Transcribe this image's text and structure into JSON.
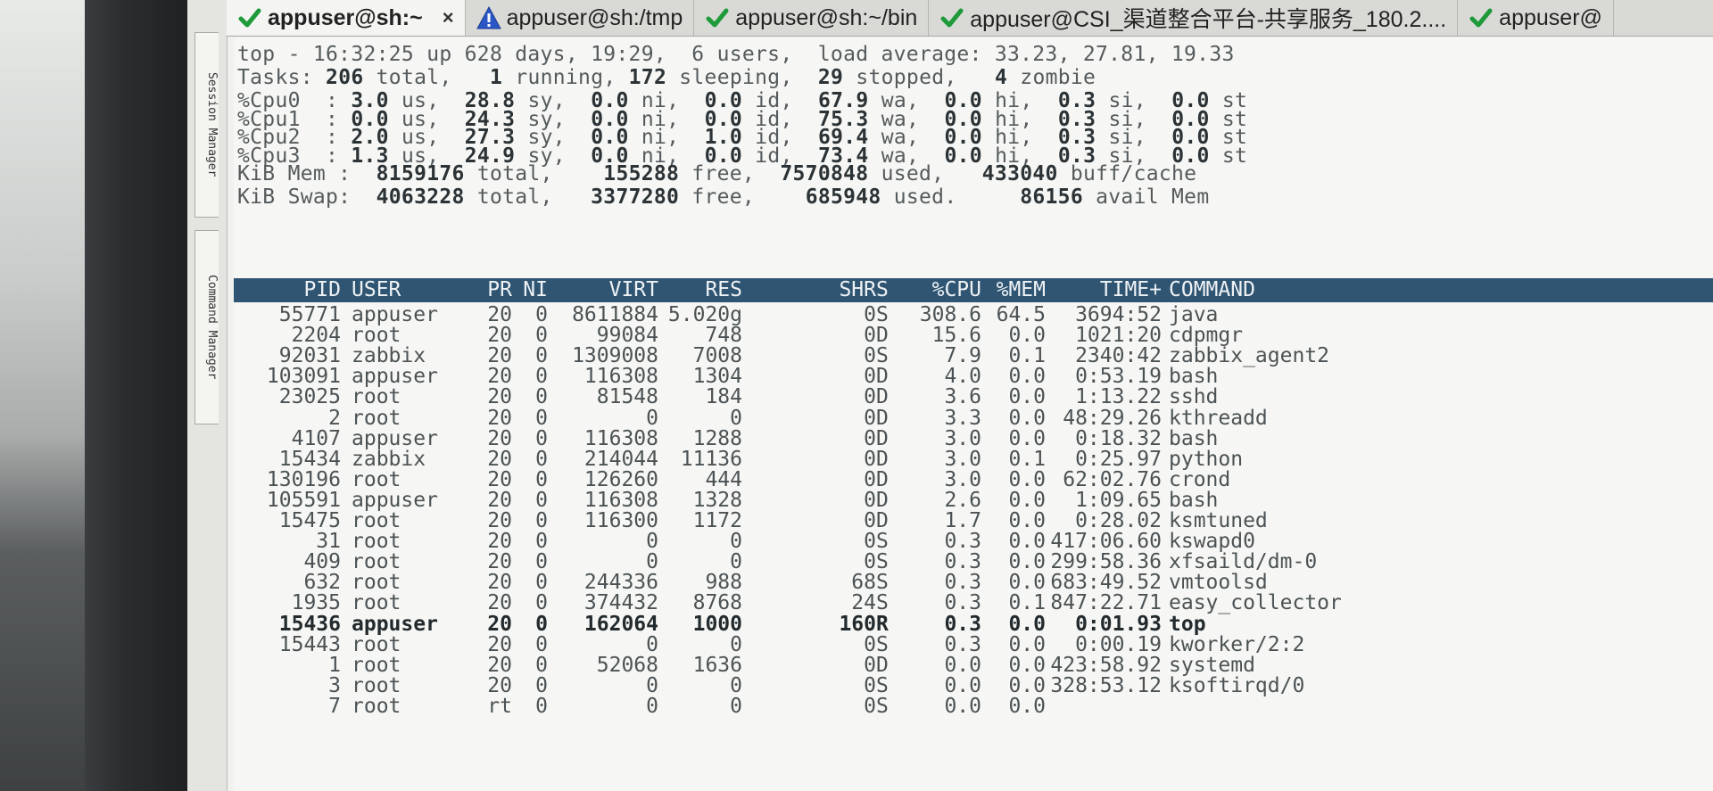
{
  "side_panel": {
    "session_manager": "Session Manager",
    "command_manager": "Command Manager"
  },
  "tabs": [
    {
      "label": "appuser@sh:~",
      "icon": "check-icon",
      "active": true,
      "close": "×"
    },
    {
      "label": "appuser@sh:/tmp",
      "icon": "warning-icon"
    },
    {
      "label": "appuser@sh:~/bin",
      "icon": "check-icon"
    },
    {
      "label": "appuser@CSI_渠道整合平台-共享服务_180.2....",
      "icon": "check-icon"
    },
    {
      "label": "appuser@",
      "icon": "check-icon"
    }
  ],
  "summary": {
    "line1": "top - 16:32:25 up 628 days, 19:29,  6 users,  load average: 33.23, 27.81, 19.33",
    "tasks": {
      "label": "Tasks:",
      "total": "206",
      "total_lbl": "total,",
      "running": "1",
      "running_lbl": "running,",
      "sleeping": "172",
      "sleeping_lbl": "sleeping,",
      "stopped": "29",
      "stopped_lbl": "stopped,",
      "zombie": "4",
      "zombie_lbl": "zombie"
    },
    "cpus": [
      {
        "label": "%Cpu0  :",
        "us": "3.0",
        "sy": "28.8",
        "ni": "0.0",
        "id": "0.0",
        "wa": "67.9",
        "hi": "0.0",
        "si": "0.3",
        "st": "0.0"
      },
      {
        "label": "%Cpu1  :",
        "us": "0.0",
        "sy": "24.3",
        "ni": "0.0",
        "id": "0.0",
        "wa": "75.3",
        "hi": "0.0",
        "si": "0.3",
        "st": "0.0"
      },
      {
        "label": "%Cpu2  :",
        "us": "2.0",
        "sy": "27.3",
        "ni": "0.0",
        "id": "1.0",
        "wa": "69.4",
        "hi": "0.0",
        "si": "0.3",
        "st": "0.0"
      },
      {
        "label": "%Cpu3  :",
        "us": "1.3",
        "sy": "24.9",
        "ni": "0.0",
        "id": "0.0",
        "wa": "73.4",
        "hi": "0.0",
        "si": "0.3",
        "st": "0.0"
      }
    ],
    "cpu_units": {
      "us": "us,",
      "sy": "sy,",
      "ni": "ni,",
      "id": "id,",
      "wa": "wa,",
      "hi": "hi,",
      "si": "si,",
      "st": "st"
    },
    "mem": {
      "label": "KiB Mem :",
      "total": "8159176",
      "total_lbl": "total,",
      "free": "155288",
      "free_lbl": "free,",
      "used": "7570848",
      "used_lbl": "used,",
      "buff": "433040",
      "buff_lbl": "buff/cache"
    },
    "swap": {
      "label": "KiB Swap:",
      "total": "4063228",
      "total_lbl": "total,",
      "free": "3377280",
      "free_lbl": "free,",
      "used": "685948",
      "used_lbl": "used.",
      "avail": "86156",
      "avail_lbl": "avail Mem"
    }
  },
  "columns": [
    "PID",
    "USER",
    "PR",
    "NI",
    "VIRT",
    "RES",
    "SHR",
    "S",
    "%CPU",
    "%MEM",
    "TIME+",
    "COMMAND"
  ],
  "processes": [
    [
      "55771",
      "appuser",
      "20",
      "0",
      "8611884",
      "5.020g",
      "0",
      "S",
      "308.6",
      "64.5",
      "3694:52",
      "java"
    ],
    [
      "2204",
      "root",
      "20",
      "0",
      "99084",
      "748",
      "0",
      "D",
      "15.6",
      "0.0",
      "1021:20",
      "cdpmgr"
    ],
    [
      "92031",
      "zabbix",
      "20",
      "0",
      "1309008",
      "7008",
      "0",
      "S",
      "7.9",
      "0.1",
      "2340:42",
      "zabbix_agent2"
    ],
    [
      "103091",
      "appuser",
      "20",
      "0",
      "116308",
      "1304",
      "0",
      "D",
      "4.0",
      "0.0",
      "0:53.19",
      "bash"
    ],
    [
      "23025",
      "root",
      "20",
      "0",
      "81548",
      "184",
      "0",
      "D",
      "3.6",
      "0.0",
      "1:13.22",
      "sshd"
    ],
    [
      "2",
      "root",
      "20",
      "0",
      "0",
      "0",
      "0",
      "D",
      "3.3",
      "0.0",
      "48:29.26",
      "kthreadd"
    ],
    [
      "4107",
      "appuser",
      "20",
      "0",
      "116308",
      "1288",
      "0",
      "D",
      "3.0",
      "0.0",
      "0:18.32",
      "bash"
    ],
    [
      "15434",
      "zabbix",
      "20",
      "0",
      "214044",
      "11136",
      "0",
      "D",
      "3.0",
      "0.1",
      "0:25.97",
      "python"
    ],
    [
      "130196",
      "root",
      "20",
      "0",
      "126260",
      "444",
      "0",
      "D",
      "3.0",
      "0.0",
      "62:02.76",
      "crond"
    ],
    [
      "105591",
      "appuser",
      "20",
      "0",
      "116308",
      "1328",
      "0",
      "D",
      "2.6",
      "0.0",
      "1:09.65",
      "bash"
    ],
    [
      "15475",
      "root",
      "20",
      "0",
      "116300",
      "1172",
      "0",
      "D",
      "1.7",
      "0.0",
      "0:28.02",
      "ksmtuned"
    ],
    [
      "31",
      "root",
      "20",
      "0",
      "0",
      "0",
      "0",
      "S",
      "0.3",
      "0.0",
      "417:06.60",
      "kswapd0"
    ],
    [
      "409",
      "root",
      "20",
      "0",
      "0",
      "0",
      "0",
      "S",
      "0.3",
      "0.0",
      "299:58.36",
      "xfsaild/dm-0"
    ],
    [
      "632",
      "root",
      "20",
      "0",
      "244336",
      "988",
      "68",
      "S",
      "0.3",
      "0.0",
      "683:49.52",
      "vmtoolsd"
    ],
    [
      "1935",
      "root",
      "20",
      "0",
      "374432",
      "8768",
      "24",
      "S",
      "0.3",
      "0.1",
      "847:22.71",
      "easy_collector"
    ],
    [
      "15436",
      "appuser",
      "20",
      "0",
      "162064",
      "1000",
      "160",
      "R",
      "0.3",
      "0.0",
      "0:01.93",
      "top"
    ],
    [
      "15443",
      "root",
      "20",
      "0",
      "0",
      "0",
      "0",
      "S",
      "0.3",
      "0.0",
      "0:00.19",
      "kworker/2:2"
    ],
    [
      "1",
      "root",
      "20",
      "0",
      "52068",
      "1636",
      "0",
      "D",
      "0.0",
      "0.0",
      "423:58.92",
      "systemd"
    ],
    [
      "3",
      "root",
      "20",
      "0",
      "0",
      "0",
      "0",
      "S",
      "0.0",
      "0.0",
      "328:53.12",
      "ksoftirqd/0"
    ],
    [
      "7",
      "root",
      "rt",
      "0",
      "0",
      "0",
      "0",
      "S",
      "0.0",
      "0.0",
      "",
      ""
    ]
  ],
  "highlight_row": 15,
  "colors": {
    "header_bg": "#2f5572",
    "check": "#1f9a3a",
    "warning": "#2a56c6"
  }
}
